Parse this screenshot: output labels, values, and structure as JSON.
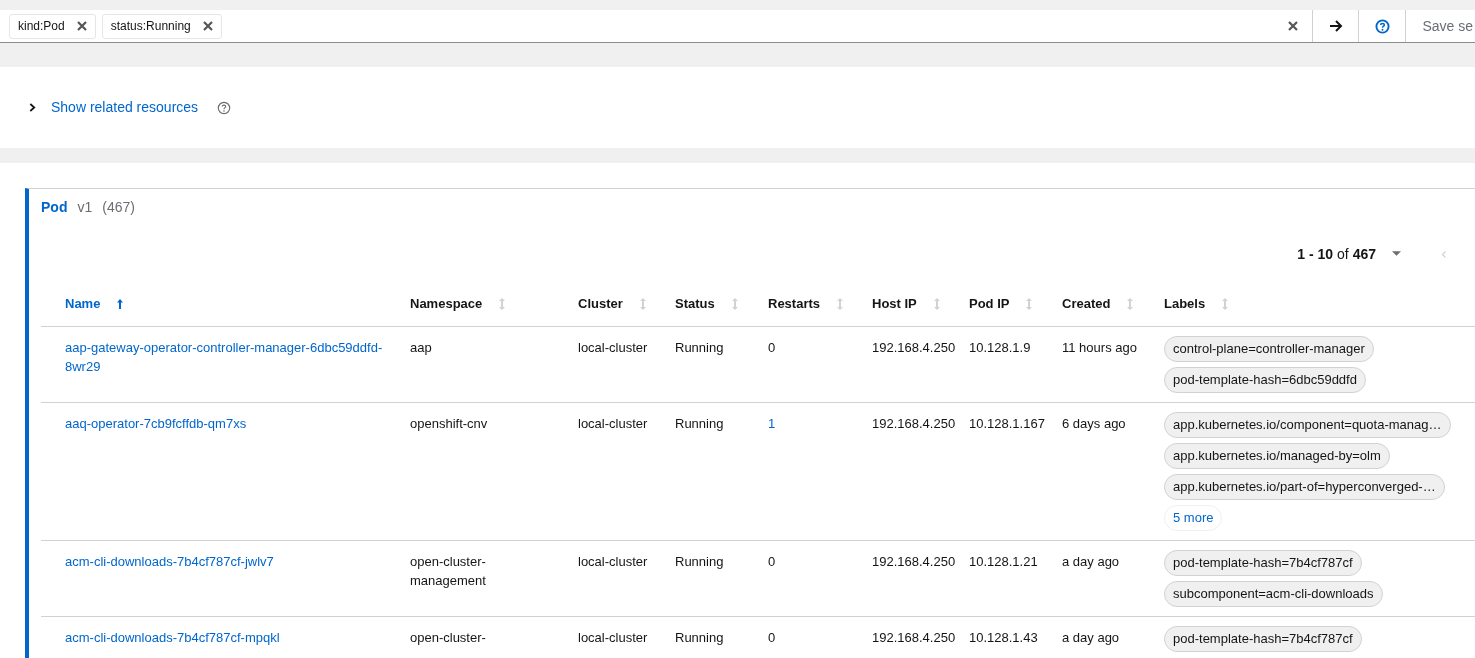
{
  "search": {
    "chips": [
      "kind:Pod",
      "status:Running"
    ],
    "save_label": "Save se"
  },
  "related": {
    "label": "Show related resources",
    "expanded": false
  },
  "resource": {
    "kind": "Pod",
    "version": "v1",
    "count": "(467)"
  },
  "pagination": {
    "range": "**1 - 10** of **467**"
  },
  "table": {
    "columns": [
      {
        "label": "Name",
        "sorted": true
      },
      {
        "label": "Namespace",
        "sorted": false
      },
      {
        "label": "Cluster",
        "sorted": false
      },
      {
        "label": "Status",
        "sorted": false
      },
      {
        "label": "Restarts",
        "sorted": false
      },
      {
        "label": "Host IP",
        "sorted": false
      },
      {
        "label": "Pod IP",
        "sorted": false
      },
      {
        "label": "Created",
        "sorted": false
      },
      {
        "label": "Labels",
        "sorted": false
      }
    ],
    "rows": [
      {
        "name": "aap-gateway-operator-controller-manager-6dbc59ddfd-8wr29",
        "namespace": "aap",
        "cluster": "local-cluster",
        "status": "Running",
        "restarts": "0",
        "restarts_linked": false,
        "host_ip": "192.168.4.250",
        "pod_ip": "10.128.1.9",
        "created": "11 hours ago",
        "labels": [
          "control-plane=controller-manager",
          "pod-template-hash=6dbc59ddfd"
        ]
      },
      {
        "name": "aaq-operator-7cb9fcffdb-qm7xs",
        "namespace": "openshift-cnv",
        "cluster": "local-cluster",
        "status": "Running",
        "restarts": "1",
        "restarts_linked": true,
        "host_ip": "192.168.4.250",
        "pod_ip": "10.128.1.167",
        "created": "6 days ago",
        "labels": [
          "app.kubernetes.io/component=quota-manag…",
          "app.kubernetes.io/managed-by=olm",
          "app.kubernetes.io/part-of=hyperconverged-…"
        ],
        "more": "5 more"
      },
      {
        "name": "acm-cli-downloads-7b4cf787cf-jwlv7",
        "namespace": "open-cluster-management",
        "cluster": "local-cluster",
        "status": "Running",
        "restarts": "0",
        "restarts_linked": false,
        "host_ip": "192.168.4.250",
        "pod_ip": "10.128.1.21",
        "created": "a day ago",
        "labels": [
          "pod-template-hash=7b4cf787cf",
          "subcomponent=acm-cli-downloads"
        ]
      },
      {
        "name": "acm-cli-downloads-7b4cf787cf-mpqkl",
        "namespace": "open-cluster-",
        "cluster": "local-cluster",
        "status": "Running",
        "restarts": "0",
        "restarts_linked": false,
        "host_ip": "192.168.4.250",
        "pod_ip": "10.128.1.43",
        "created": "a day ago",
        "labels": [
          "pod-template-hash=7b4cf787cf"
        ]
      }
    ]
  }
}
